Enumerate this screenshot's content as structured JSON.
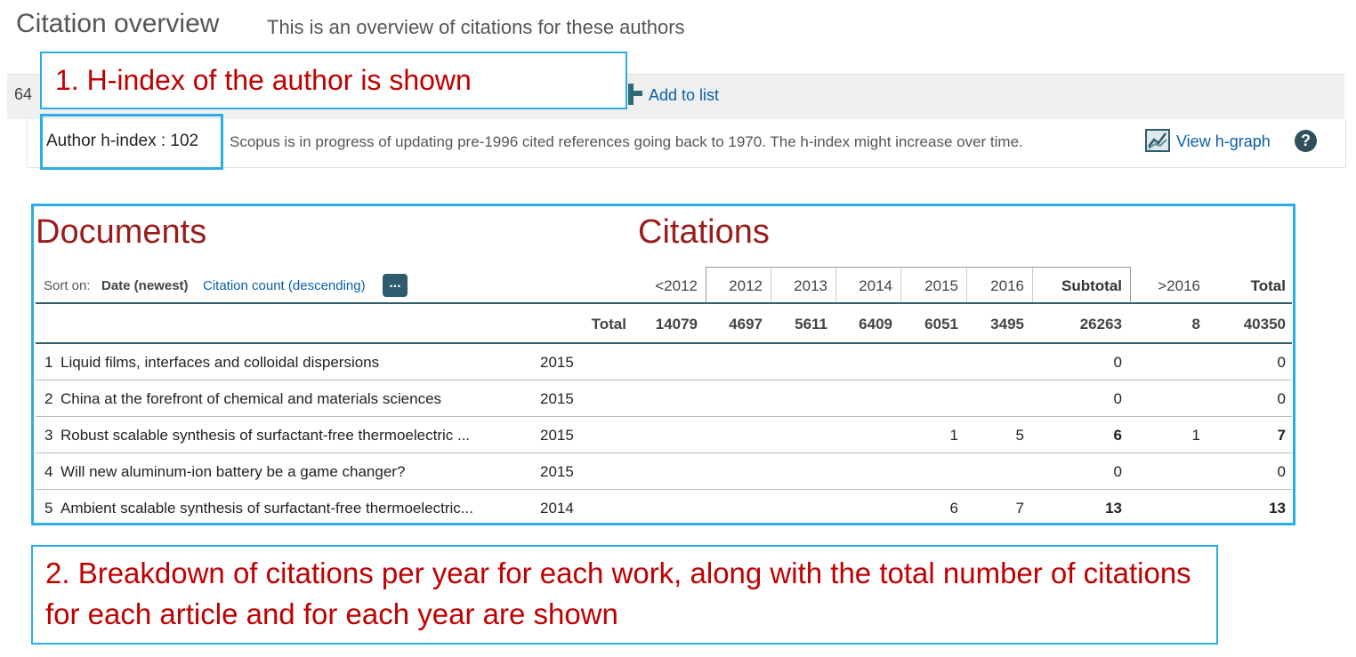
{
  "header": {
    "title": "Citation overview",
    "subtitle": "This is an overview of citations for these authors"
  },
  "toolbar": {
    "count_partial": "64",
    "add_to_list": "Add to list"
  },
  "author": {
    "hindex_label": "Author h-index : 102",
    "note": "Scopus is in progress of updating pre-1996 cited references going back to 1970. The h-index might increase over time.",
    "view_hgraph": "View h-graph",
    "help": "?"
  },
  "callouts": {
    "first": "1. H-index of the author is shown",
    "second": "2. Breakdown of citations per year for each work, along with the total number of citations for each article and for each year are shown"
  },
  "table": {
    "documents_heading": "Documents",
    "citations_heading": "Citations",
    "sort": {
      "label": "Sort on:",
      "active": "Date (newest)",
      "alternative": "Citation count (descending)",
      "more": "..."
    },
    "columns": [
      "<2012",
      "2012",
      "2013",
      "2014",
      "2015",
      "2016",
      "Subtotal",
      ">2016",
      "Total"
    ],
    "totals_label": "Total",
    "totals": [
      "14079",
      "4697",
      "5611",
      "6409",
      "6051",
      "3495",
      "26263",
      "8",
      "40350"
    ],
    "rows": [
      {
        "n": "1",
        "title": "Liquid films, interfaces and colloidal dispersions",
        "year": "2015",
        "values": [
          "",
          "",
          "",
          "",
          "",
          "",
          "0",
          "",
          "0"
        ]
      },
      {
        "n": "2",
        "title": "China at the forefront of chemical and materials sciences",
        "year": "2015",
        "values": [
          "",
          "",
          "",
          "",
          "",
          "",
          "0",
          "",
          "0"
        ]
      },
      {
        "n": "3",
        "title": "Robust scalable synthesis of surfactant-free thermoelectric ...",
        "year": "2015",
        "values": [
          "",
          "",
          "",
          "",
          "1",
          "5",
          "6",
          "1",
          "7"
        ]
      },
      {
        "n": "4",
        "title": "Will new aluminum-ion battery be a game changer?",
        "year": "2015",
        "values": [
          "",
          "",
          "",
          "",
          "",
          "",
          "0",
          "",
          "0"
        ]
      },
      {
        "n": "5",
        "title": "Ambient scalable synthesis of surfactant-free thermoelectric...",
        "year": "2014",
        "values": [
          "",
          "",
          "",
          "",
          "6",
          "7",
          "13",
          "",
          "13"
        ]
      }
    ]
  },
  "colors": {
    "callout_border": "#29aee6",
    "callout_text": "#c00000",
    "heading": "#9b1c1c",
    "link": "#0a5fa8"
  }
}
